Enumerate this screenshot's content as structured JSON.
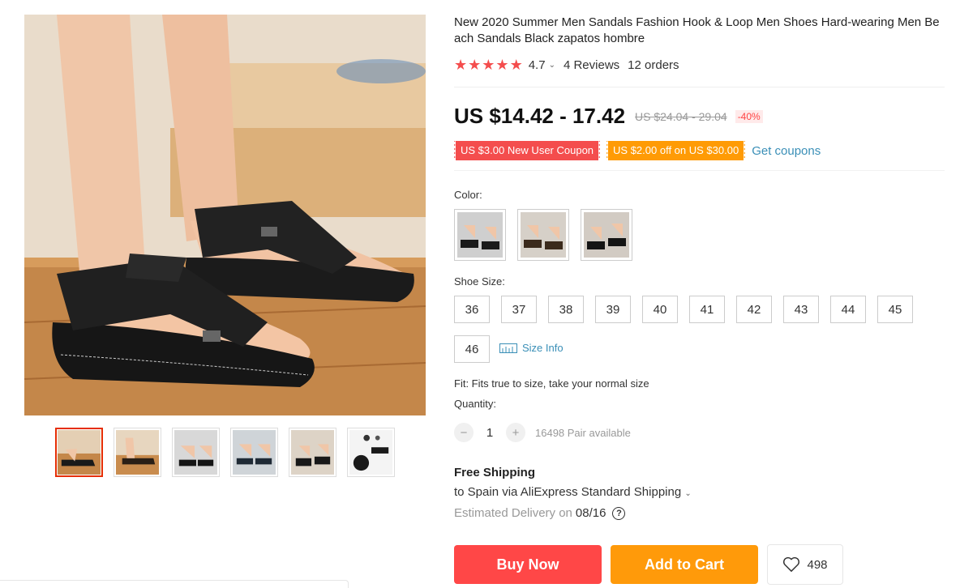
{
  "product": {
    "title": "New 2020 Summer Men Sandals Fashion Hook & Loop Men Shoes Hard-wearing Men Beach Sandals Black zapatos hombre",
    "rating": "4.7",
    "reviews": "4 Reviews",
    "orders": "12 orders",
    "stars": 5
  },
  "price": {
    "current": "US $14.42 - 17.42",
    "original": "US $24.04 - 29.04",
    "discount": "-40%"
  },
  "coupons": {
    "new_user": "US $3.00 New User Coupon",
    "store": "US $2.00 off on US $30.00",
    "get_label": "Get coupons"
  },
  "color": {
    "label": "Color:"
  },
  "size": {
    "label": "Shoe Size:",
    "options": [
      "36",
      "37",
      "38",
      "39",
      "40",
      "41",
      "42",
      "43",
      "44",
      "45",
      "46"
    ],
    "info_label": "Size Info"
  },
  "fit": "Fit: Fits true to size, take your normal size",
  "quantity": {
    "label": "Quantity:",
    "value": "1",
    "available": "16498 Pair available",
    "minus": "−",
    "plus": "+"
  },
  "shipping": {
    "title": "Free Shipping",
    "line": "to Spain via AliExpress Standard Shipping",
    "estimated": "Estimated Delivery on",
    "date": "08/16"
  },
  "actions": {
    "buy_now": "Buy Now",
    "add_to_cart": "Add to Cart",
    "wishlist_count": "498"
  },
  "colors": {
    "accent_red": "#ff4747",
    "accent_orange": "#ff9a0a",
    "link_blue": "#3a8fb7",
    "star_red": "#f44d4d"
  }
}
